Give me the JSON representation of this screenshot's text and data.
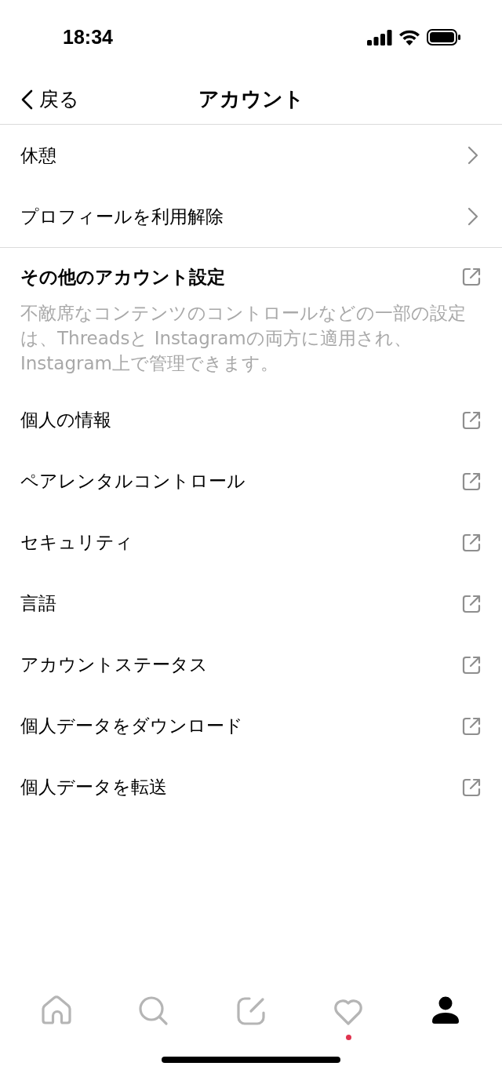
{
  "status_bar": {
    "time": "18:34"
  },
  "header": {
    "back": "戻る",
    "title": "アカウント"
  },
  "top_items": [
    {
      "label": "休憩"
    },
    {
      "label": "プロフィールを利用解除"
    }
  ],
  "other_settings": {
    "title": "その他のアカウント設定",
    "description": "不敵席なコンテンツのコントロールなどの一部の設定は、Threadsと Instagramの両方に適用され、Instagram上で管理できます。",
    "items": [
      {
        "label": "個人の情報"
      },
      {
        "label": "ペアレンタルコントロール"
      },
      {
        "label": "セキュリティ"
      },
      {
        "label": "言語"
      },
      {
        "label": "アカウントステータス"
      },
      {
        "label": "個人データをダウンロード"
      },
      {
        "label": "個人データを転送"
      }
    ]
  },
  "tab_bar": [
    {
      "kind": "home",
      "selected": false,
      "badge": false
    },
    {
      "kind": "search",
      "selected": false,
      "badge": false
    },
    {
      "kind": "compose",
      "selected": false,
      "badge": false
    },
    {
      "kind": "activity",
      "selected": false,
      "badge": true
    },
    {
      "kind": "profile",
      "selected": true,
      "badge": false
    }
  ]
}
